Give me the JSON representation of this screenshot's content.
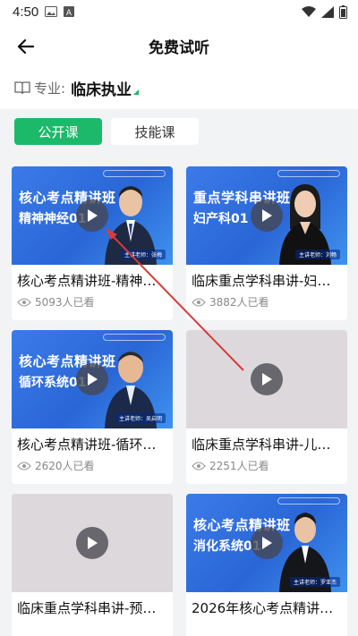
{
  "status_bar": {
    "time": "4:50",
    "left_icons": [
      "image-icon",
      "a-notification-icon"
    ],
    "right_icons": [
      "wifi-icon",
      "signal-icon",
      "battery-icon"
    ]
  },
  "header": {
    "title": "免费试听",
    "back_icon": "arrow-left-icon"
  },
  "major": {
    "label": "专业:",
    "value": "临床执业",
    "icon": "book-icon"
  },
  "tabs": [
    {
      "label": "公开课",
      "active": true
    },
    {
      "label": "技能课",
      "active": false
    }
  ],
  "colors": {
    "accent": "#1db96b",
    "thumb_blue": "#2a66d6",
    "annotation_arrow": "#d93b3b",
    "background": "#f2f3f5"
  },
  "courses": [
    {
      "title": "核心考点精讲班-精神…",
      "views": "5093人已看",
      "thumb": {
        "style": "blue",
        "line1": "核心考点精讲班",
        "line2": "精神神经01",
        "teacher": "主讲老师：张梅"
      }
    },
    {
      "title": "临床重点学科串讲-妇…",
      "views": "3882人已看",
      "thumb": {
        "style": "blue",
        "line1": "重点学科串讲班",
        "line2": "妇产科01",
        "teacher": "主讲老师：刘畅"
      }
    },
    {
      "title": "核心考点精讲班-循环…",
      "views": "2620人已看",
      "thumb": {
        "style": "blue",
        "line1": "核心考点精讲班",
        "line2": "循环系统01",
        "teacher": "主讲老师：吴启明"
      }
    },
    {
      "title": "临床重点学科串讲-儿…",
      "views": "2251人已看",
      "thumb": {
        "style": "gray",
        "line1": "",
        "line2": "",
        "teacher": ""
      }
    },
    {
      "title": "临床重点学科串讲-预…",
      "views": "",
      "thumb": {
        "style": "gray",
        "line1": "",
        "line2": "",
        "teacher": ""
      }
    },
    {
      "title": "2026年核心考点精讲…",
      "views": "",
      "thumb": {
        "style": "blue",
        "line1": "核心考点精讲班",
        "line2": "消化系统01",
        "teacher": "主讲老师：罗亚杰"
      }
    }
  ]
}
